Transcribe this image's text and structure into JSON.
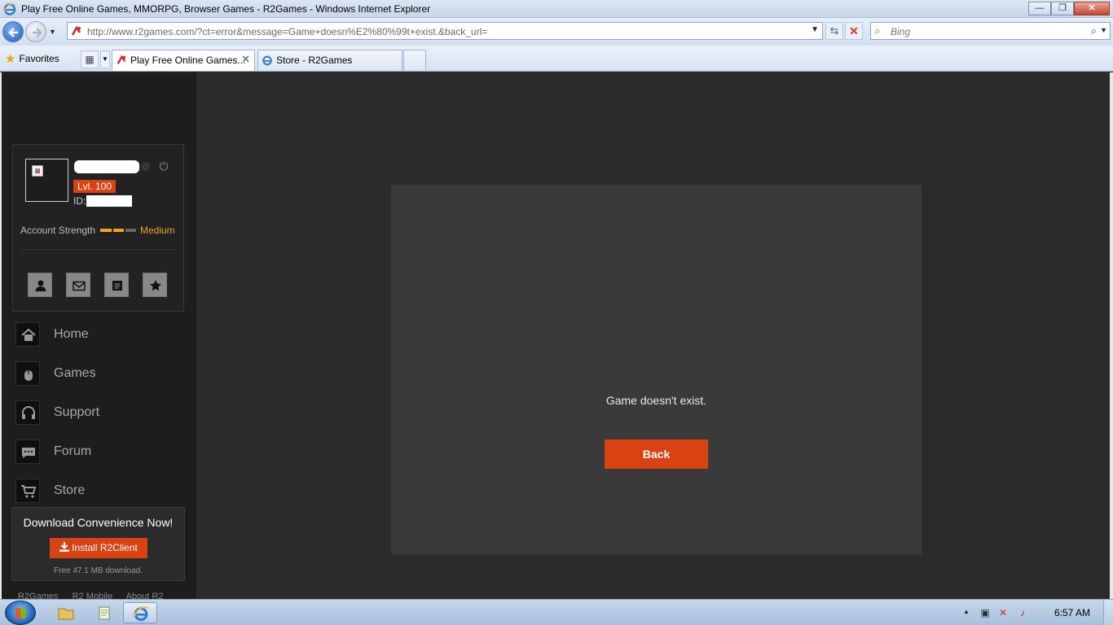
{
  "window": {
    "title": "Play Free Online Games, MMORPG, Browser Games - R2Games - Windows Internet Explorer",
    "minimize": "—",
    "maximize": "❐",
    "close": "✕"
  },
  "address": {
    "url": "http://www.r2games.com/?ct=error&message=Game+doesn%E2%80%99t+exist.&back_url=",
    "search_placeholder": "Bing"
  },
  "favorites": {
    "label": "Favorites"
  },
  "tabs": [
    {
      "label": "Play Free Online Games...",
      "active": true
    },
    {
      "label": "Store - R2Games",
      "active": false
    }
  ],
  "user": {
    "level": "Lvl. 100",
    "id_label": "ID:",
    "account_strength_label": "Account Strength",
    "account_strength_value": "Medium",
    "account_strength_level": 0.67
  },
  "nav": [
    {
      "label": "Home",
      "icon": "home-icon"
    },
    {
      "label": "Games",
      "icon": "mouse-icon"
    },
    {
      "label": "Support",
      "icon": "headset-icon"
    },
    {
      "label": "Forum",
      "icon": "chat-icon"
    },
    {
      "label": "Store",
      "icon": "cart-icon"
    }
  ],
  "download": {
    "title": "Download Convenience Now!",
    "button": "Install R2Client",
    "note": "Free 47.1 MB download."
  },
  "footer_links": [
    "R2Games",
    "R2 Mobile",
    "About R2"
  ],
  "error": {
    "message": "Game doesn't exist.",
    "back_button": "Back"
  },
  "taskbar": {
    "clock": "6:57 AM"
  },
  "colors": {
    "accent": "#d94314",
    "strength": "#f0a31b",
    "panel": "#3a3a3a",
    "sidebar": "#1d1d1d"
  }
}
